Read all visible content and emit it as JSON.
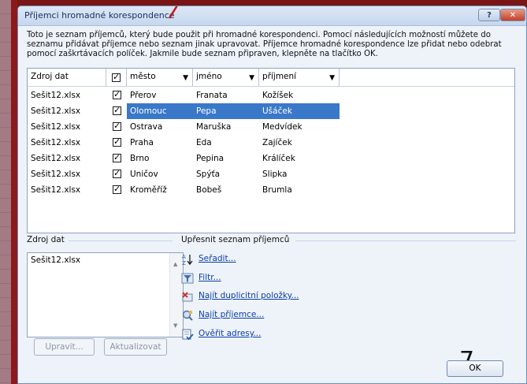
{
  "dialog": {
    "title": "Příjemci hromadné korespondence",
    "help_label": "?",
    "close_label": "✕",
    "intro": "Toto je seznam příjemců, který bude použit při hromadné korespondenci. Pomocí následujících možností můžete do seznamu přidávat příjemce nebo seznam jinak upravovat. Příjemce hromadné korespondence lze přidat nebo odebrat pomocí zaškrtávacích políček. Jakmile bude seznam připraven, klepněte na tlačítko OK."
  },
  "table": {
    "headers": [
      "Zdroj dat",
      "",
      "město",
      "jméno",
      "příjmení"
    ],
    "rows": [
      {
        "source": "Sešit12.xlsx",
        "checked": true,
        "mesto": "Přerov",
        "jmeno": "Franata",
        "prijmeni": "Kožíšek",
        "selected": false
      },
      {
        "source": "Sešit12.xlsx",
        "checked": true,
        "mesto": "Olomouc",
        "jmeno": "Pepa",
        "prijmeni": "Ušáček",
        "selected": true
      },
      {
        "source": "Sešit12.xlsx",
        "checked": true,
        "mesto": "Ostrava",
        "jmeno": "Maruška",
        "prijmeni": "Medvídek",
        "selected": false
      },
      {
        "source": "Sešit12.xlsx",
        "checked": true,
        "mesto": "Praha",
        "jmeno": "Eda",
        "prijmeni": "Zajíček",
        "selected": false
      },
      {
        "source": "Sešit12.xlsx",
        "checked": true,
        "mesto": "Brno",
        "jmeno": "Pepina",
        "prijmeni": "Králíček",
        "selected": false
      },
      {
        "source": "Sešit12.xlsx",
        "checked": true,
        "mesto": "Uničov",
        "jmeno": "Spýťa",
        "prijmeni": "Slipka",
        "selected": false
      },
      {
        "source": "Sešit12.xlsx",
        "checked": true,
        "mesto": "Kroměříž",
        "jmeno": "Bobeš",
        "prijmeni": "Brumla",
        "selected": false
      }
    ]
  },
  "source_section": {
    "title": "Zdroj dat",
    "items": [
      "Sešit12.xlsx"
    ],
    "edit_label": "Upravit...",
    "refresh_label": "Aktualizovat"
  },
  "refine_section": {
    "title": "Upřesnit seznam příjemců",
    "links": [
      {
        "label": "Seřadit...",
        "icon": "sort-az-icon"
      },
      {
        "label": "Filtr...",
        "icon": "filter-icon"
      },
      {
        "label": "Najít duplicitní položky...",
        "icon": "find-duplicates-icon"
      },
      {
        "label": "Najít příjemce...",
        "icon": "find-recipient-icon"
      },
      {
        "label": "Ověřit adresy...",
        "icon": "validate-addresses-icon"
      }
    ]
  },
  "ok_label": "OK",
  "annotation": "7",
  "colors": {
    "selection": "#3a78c9",
    "link": "#0a3ea8",
    "backdrop": "#7a1515"
  }
}
